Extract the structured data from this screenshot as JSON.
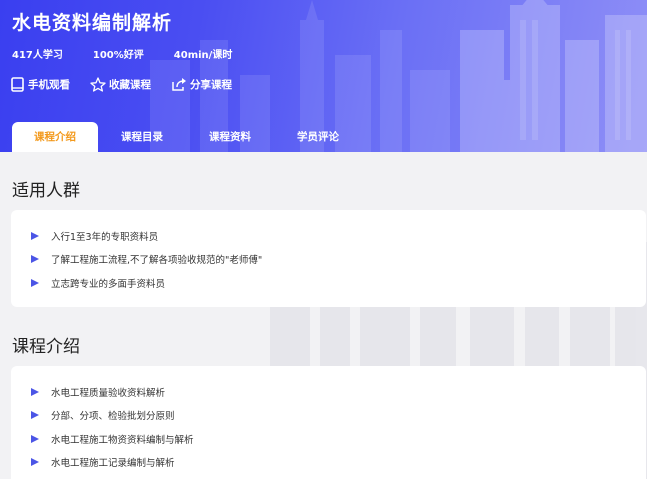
{
  "course": {
    "title": "水电资料编制解析",
    "learners": "417人学习",
    "rating": "100%好评",
    "duration": "40min/课时"
  },
  "actions": [
    {
      "label": "手机观看",
      "icon": "phone-icon"
    },
    {
      "label": "收藏课程",
      "icon": "star-icon"
    },
    {
      "label": "分享课程",
      "icon": "share-icon"
    }
  ],
  "tabs": [
    {
      "label": "课程介绍",
      "active": true
    },
    {
      "label": "课程目录",
      "active": false
    },
    {
      "label": "课程资料",
      "active": false
    },
    {
      "label": "学员评论",
      "active": false
    }
  ],
  "audience": {
    "title": "适用人群",
    "items": [
      "入行1至3年的专职资料员",
      "了解工程施工流程,不了解各项验收规范的\"老师傅\"",
      "立志跨专业的多面手资料员"
    ]
  },
  "intro": {
    "title": "课程介绍",
    "items": [
      "水电工程质量验收资料解析",
      "分部、分项、检验批划分原则",
      "水电工程施工物资资料编制与解析",
      "水电工程施工记录编制与解析"
    ]
  },
  "colors": {
    "banner": "#4a4ef2",
    "active_tab_text": "#f39a1e",
    "bullet": "#4b55e6"
  }
}
